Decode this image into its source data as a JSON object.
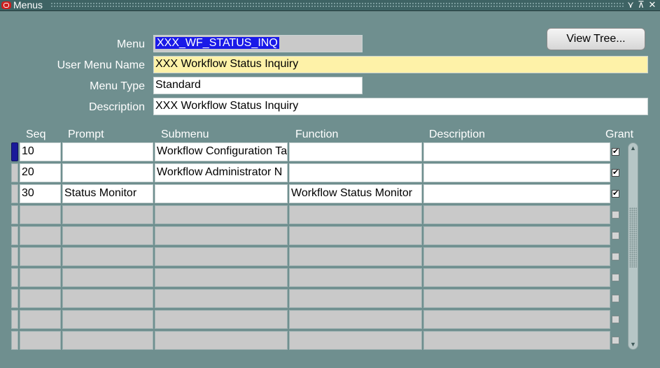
{
  "window": {
    "title": "Menus",
    "controls": [
      "⋎",
      "⊼",
      "✕"
    ]
  },
  "header": {
    "menu_label": "Menu",
    "menu_value": "XXX_WF_STATUS_INQ",
    "user_menu_name_label": "User Menu Name",
    "user_menu_name_value": "XXX Workflow Status Inquiry",
    "menu_type_label": "Menu Type",
    "menu_type_value": "Standard",
    "description_label": "Description",
    "description_value": "XXX Workflow Status Inquiry"
  },
  "view_tree_button": "View Tree...",
  "table": {
    "columns": {
      "seq": "Seq",
      "prompt": "Prompt",
      "submenu": "Submenu",
      "function": "Function",
      "description": "Description",
      "grant": "Grant"
    },
    "rows": [
      {
        "seq": "10",
        "prompt": "",
        "submenu": "Workflow Configuration Ta",
        "function": "",
        "description": "",
        "grant": true
      },
      {
        "seq": "20",
        "prompt": "",
        "submenu": "Workflow Administrator N",
        "function": "",
        "description": "",
        "grant": true
      },
      {
        "seq": "30",
        "prompt": "Status Monitor",
        "submenu": "",
        "function": "Workflow Status Monitor",
        "description": "",
        "grant": true
      },
      {
        "seq": "",
        "prompt": "",
        "submenu": "",
        "function": "",
        "description": "",
        "grant": false
      },
      {
        "seq": "",
        "prompt": "",
        "submenu": "",
        "function": "",
        "description": "",
        "grant": false
      },
      {
        "seq": "",
        "prompt": "",
        "submenu": "",
        "function": "",
        "description": "",
        "grant": false
      },
      {
        "seq": "",
        "prompt": "",
        "submenu": "",
        "function": "",
        "description": "",
        "grant": false
      },
      {
        "seq": "",
        "prompt": "",
        "submenu": "",
        "function": "",
        "description": "",
        "grant": false
      },
      {
        "seq": "",
        "prompt": "",
        "submenu": "",
        "function": "",
        "description": "",
        "grant": false
      },
      {
        "seq": "",
        "prompt": "",
        "submenu": "",
        "function": "",
        "description": "",
        "grant": false
      }
    ]
  }
}
